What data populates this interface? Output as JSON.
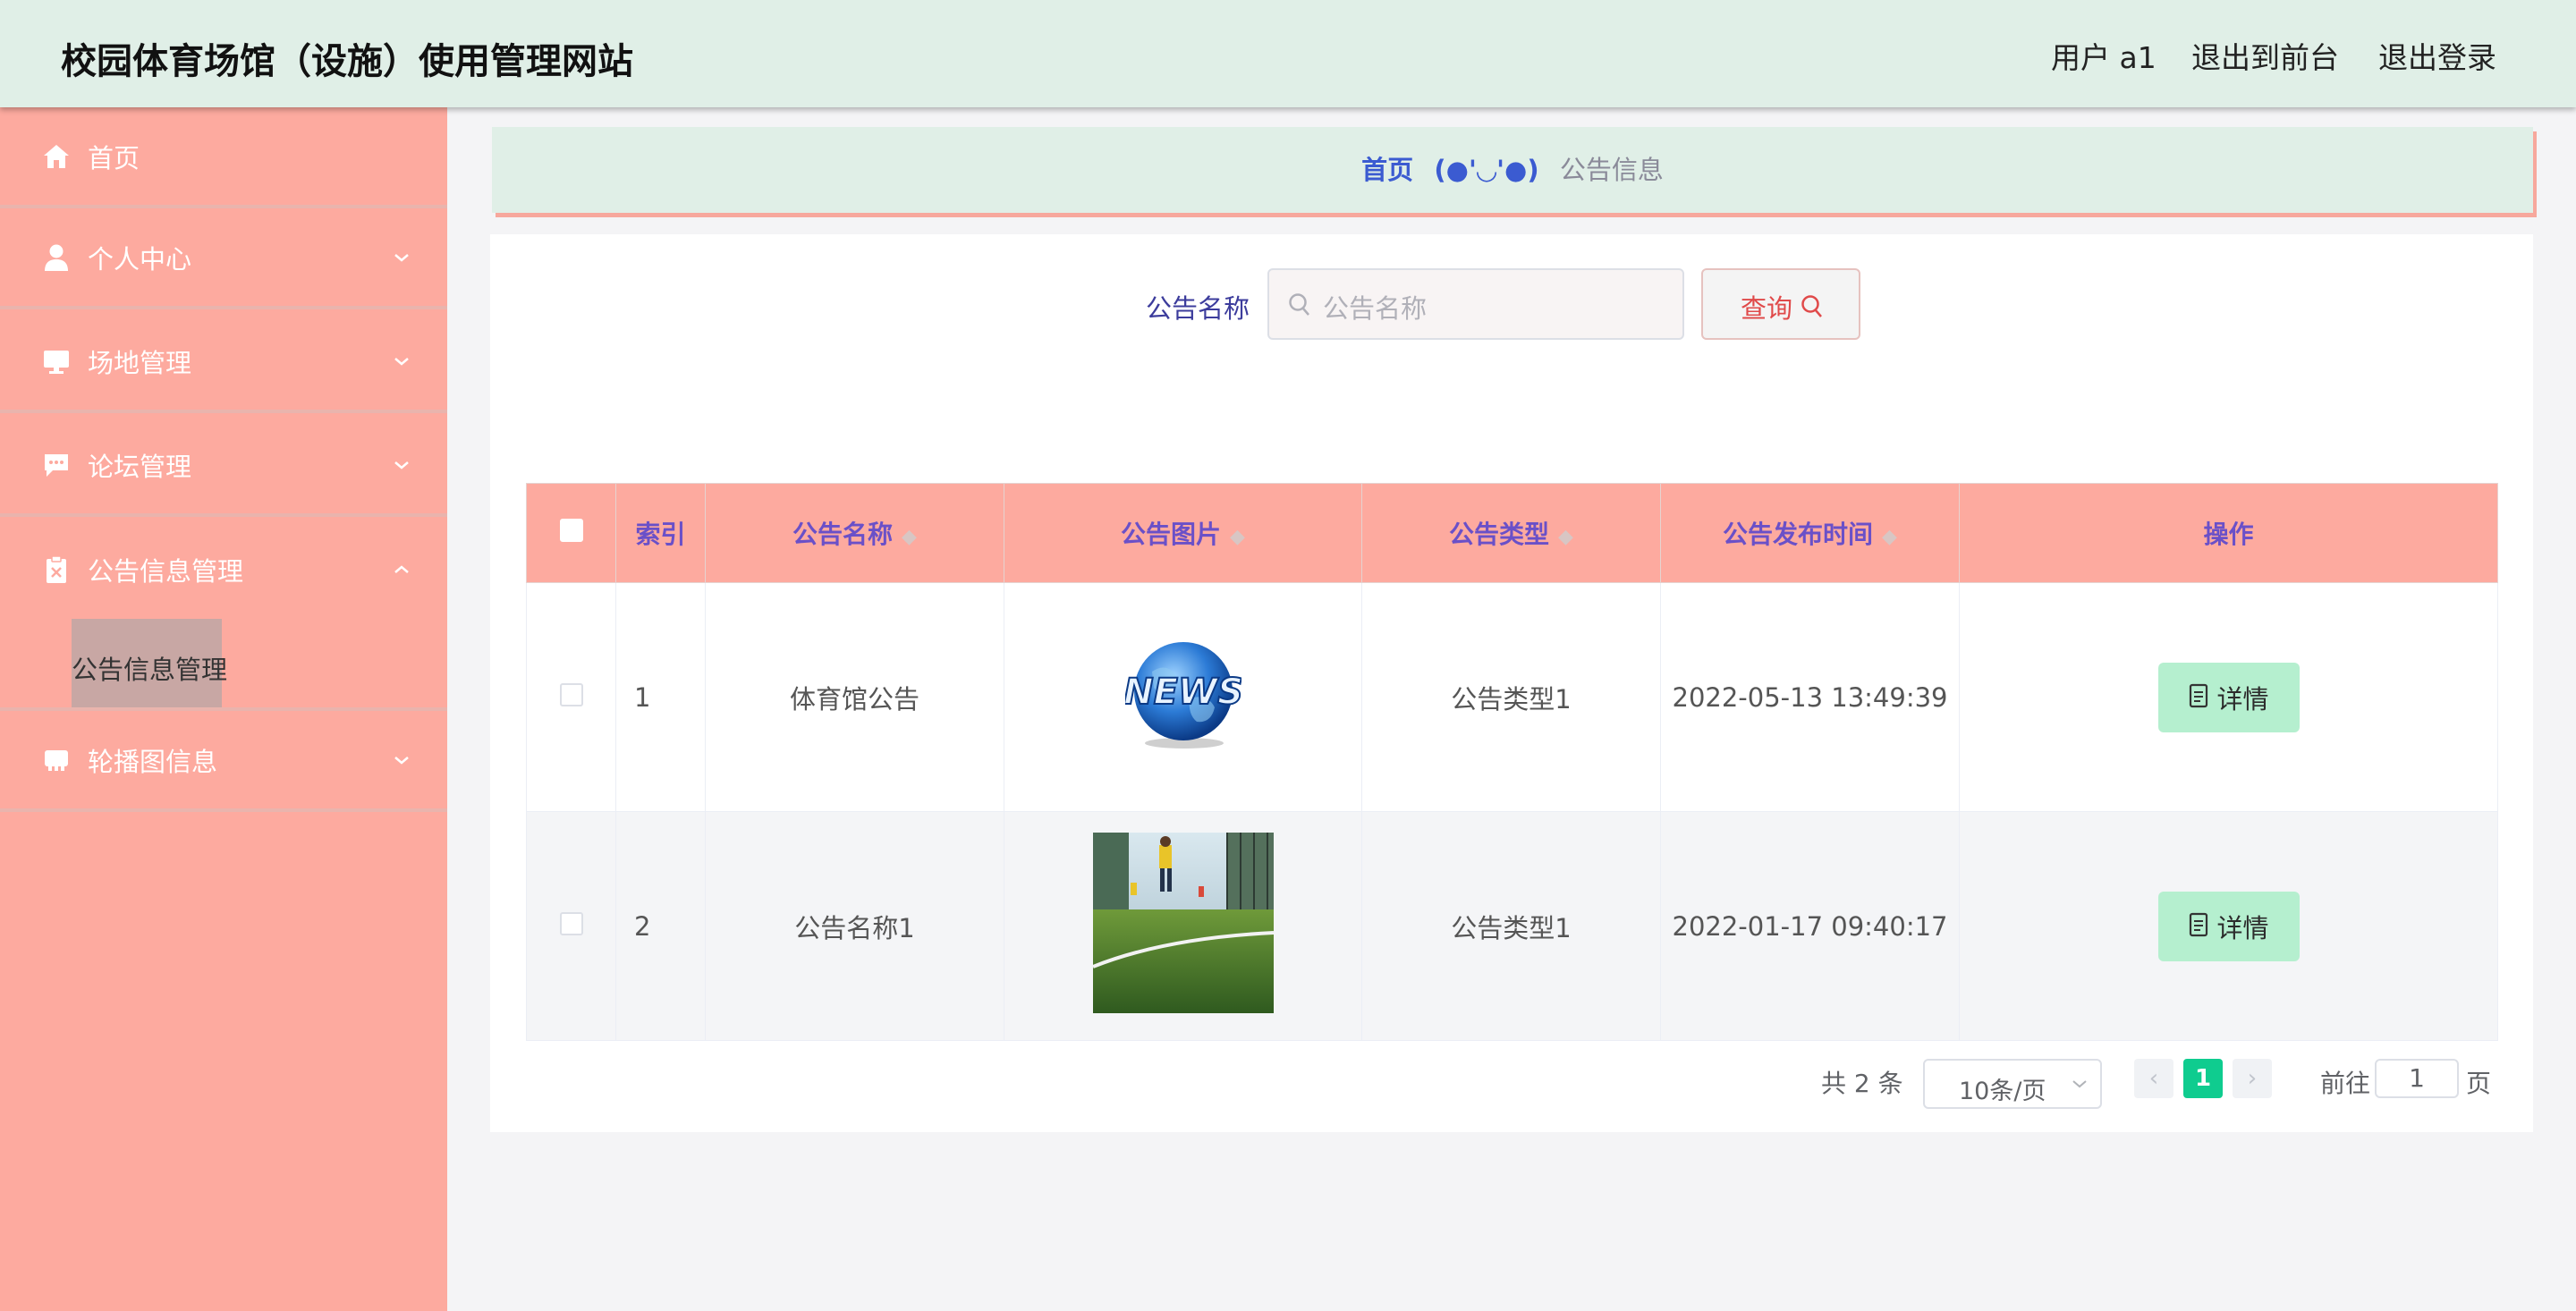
{
  "header": {
    "title": "校园体育场馆（设施）使用管理网站",
    "user": "用户 a1",
    "exit_front": "退出到前台",
    "logout": "退出登录"
  },
  "sidebar": {
    "items": [
      {
        "label": "首页",
        "icon": "home-icon"
      },
      {
        "label": "个人中心",
        "icon": "user-icon"
      },
      {
        "label": "场地管理",
        "icon": "monitor-icon"
      },
      {
        "label": "论坛管理",
        "icon": "chat-icon"
      },
      {
        "label": "公告信息管理",
        "icon": "clipboard-icon"
      },
      {
        "label": "轮播图信息",
        "icon": "carousel-icon"
      }
    ],
    "sub_item": "公告信息管理"
  },
  "breadcrumb": {
    "home": "首页",
    "separator": "(●'◡'●)",
    "current": "公告信息"
  },
  "search": {
    "label": "公告名称",
    "placeholder": "公告名称",
    "button": "查询"
  },
  "table": {
    "headers": [
      "索引",
      "公告名称",
      "公告图片",
      "公告类型",
      "公告发布时间",
      "操作"
    ],
    "rows": [
      {
        "index": "1",
        "name": "体育馆公告",
        "image": "news-globe",
        "type": "公告类型1",
        "time": "2022-05-13 13:49:39",
        "action": "详情"
      },
      {
        "index": "2",
        "name": "公告名称1",
        "image": "football-field-photo",
        "type": "公告类型1",
        "time": "2022-01-17 09:40:17",
        "action": "详情"
      }
    ]
  },
  "pagination": {
    "total": "共 2 条",
    "page_size": "10条/页",
    "current_page": "1",
    "goto_prefix": "前往",
    "goto_value": "1",
    "goto_suffix": "页"
  },
  "colors": {
    "header_bg": "#e0efe7",
    "sidebar_bg": "#fdaa9f",
    "table_header_bg": "#fdaa9f",
    "header_text": "#6a50c8",
    "detail_btn": "#b5efcf",
    "active_page": "#0fcc8f"
  }
}
